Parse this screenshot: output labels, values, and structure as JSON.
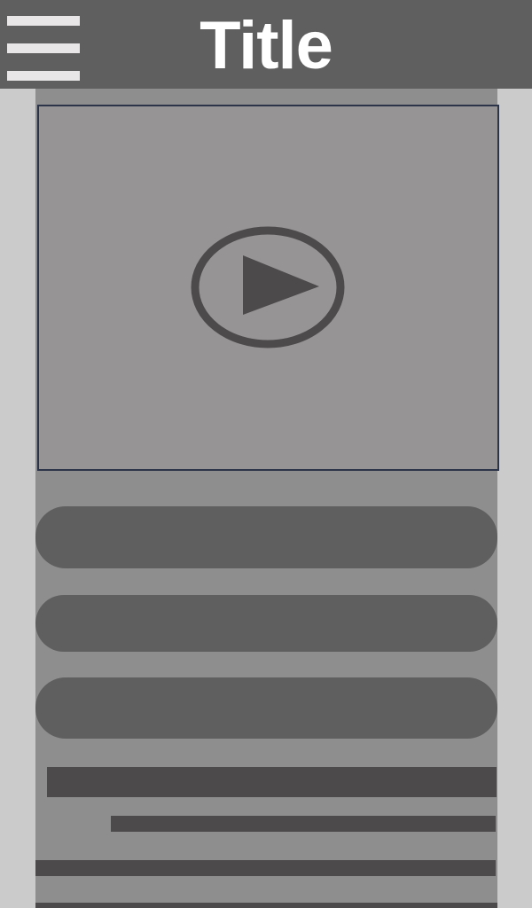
{
  "header": {
    "title": "Title",
    "menu_icon": "hamburger-menu-icon"
  },
  "video": {
    "play_icon": "play-icon"
  },
  "colors": {
    "header_bg": "#605f60",
    "page_bg": "#cbcbcb",
    "content_bg": "#8e8e8e",
    "video_bg": "#969495",
    "video_border": "#2b3448",
    "pill_bg": "#605f60",
    "text_placeholder": "#4c4a4b",
    "play_icon": "#4c4a4b",
    "title_text": "#ffffff",
    "menu_icon": "#e8e6e7"
  }
}
